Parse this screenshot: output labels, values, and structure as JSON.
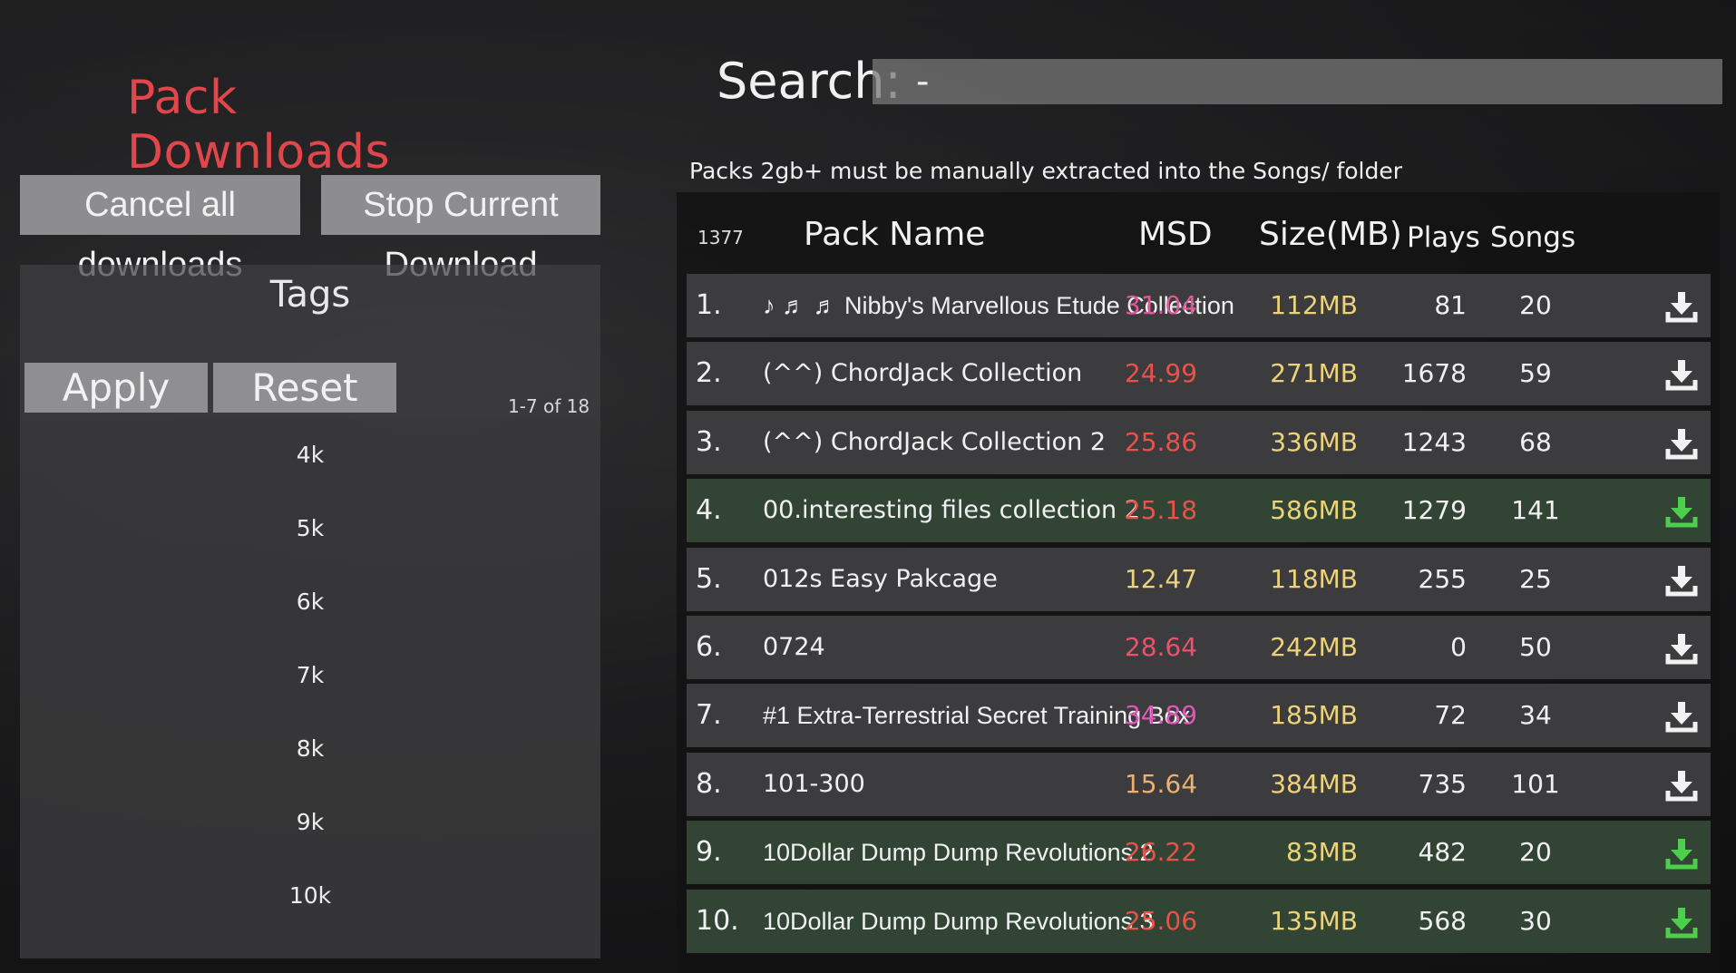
{
  "title": "Pack Downloads",
  "buttons": {
    "cancel_all": "Cancel all downloads",
    "stop_current": "Stop Current Download"
  },
  "tags": {
    "title": "Tags",
    "apply": "Apply",
    "reset": "Reset",
    "count": "1-7 of 18",
    "items": [
      "4k",
      "5k",
      "6k",
      "7k",
      "8k",
      "9k",
      "10k"
    ]
  },
  "search": {
    "label": "Search:",
    "value": "-"
  },
  "note": "Packs 2gb+ must be manually extracted into the Songs/ folder",
  "table": {
    "total_count": "1377",
    "headers": {
      "name": "Pack Name",
      "msd": "MSD",
      "size": "Size(MB)",
      "plays": "Plays",
      "songs": "Songs"
    },
    "rows": [
      {
        "rank": "1.",
        "name": "♪ ♬ ♬ Nibby's Marvellous Etude Collection",
        "msd": "31.04",
        "size": "112MB",
        "plays": "81",
        "songs": "20",
        "downloaded": false,
        "msd_color": "#e0569a"
      },
      {
        "rank": "2.",
        "name": "(^^) ChordJack Collection",
        "msd": "24.99",
        "size": "271MB",
        "plays": "1678",
        "songs": "59",
        "downloaded": false,
        "msd_color": "#e8524a"
      },
      {
        "rank": "3.",
        "name": "(^^) ChordJack Collection 2",
        "msd": "25.86",
        "size": "336MB",
        "plays": "1243",
        "songs": "68",
        "downloaded": false,
        "msd_color": "#e8524a"
      },
      {
        "rank": "4.",
        "name": "00.interesting files collection 2",
        "msd": "25.18",
        "size": "586MB",
        "plays": "1279",
        "songs": "141",
        "downloaded": true,
        "msd_color": "#e8524a"
      },
      {
        "rank": "5.",
        "name": "012s Easy Pakcage",
        "msd": "12.47",
        "size": "118MB",
        "plays": "255",
        "songs": "25",
        "downloaded": false,
        "msd_color": "#ecd27a"
      },
      {
        "rank": "6.",
        "name": "0724",
        "msd": "28.64",
        "size": "242MB",
        "plays": "0",
        "songs": "50",
        "downloaded": false,
        "msd_color": "#e8526a"
      },
      {
        "rank": "7.",
        "name": "#1 Extra-Terrestrial Secret Training Box",
        "msd": "34.89",
        "size": "185MB",
        "plays": "72",
        "songs": "34",
        "downloaded": false,
        "msd_color": "#e056b8"
      },
      {
        "rank": "8.",
        "name": "101-300",
        "msd": "15.64",
        "size": "384MB",
        "plays": "735",
        "songs": "101",
        "downloaded": false,
        "msd_color": "#ecb070"
      },
      {
        "rank": "9.",
        "name": "10Dollar Dump Dump Revolutions 2",
        "msd": "26.22",
        "size": "83MB",
        "plays": "482",
        "songs": "20",
        "downloaded": true,
        "msd_color": "#e8524a"
      },
      {
        "rank": "10.",
        "name": "10Dollar Dump Dump Revolutions 3",
        "msd": "25.06",
        "size": "135MB",
        "plays": "568",
        "songs": "30",
        "downloaded": true,
        "msd_color": "#e8524a"
      }
    ]
  },
  "icons": {
    "download_white": "#f2f2f2",
    "download_green": "#4cd04c"
  }
}
